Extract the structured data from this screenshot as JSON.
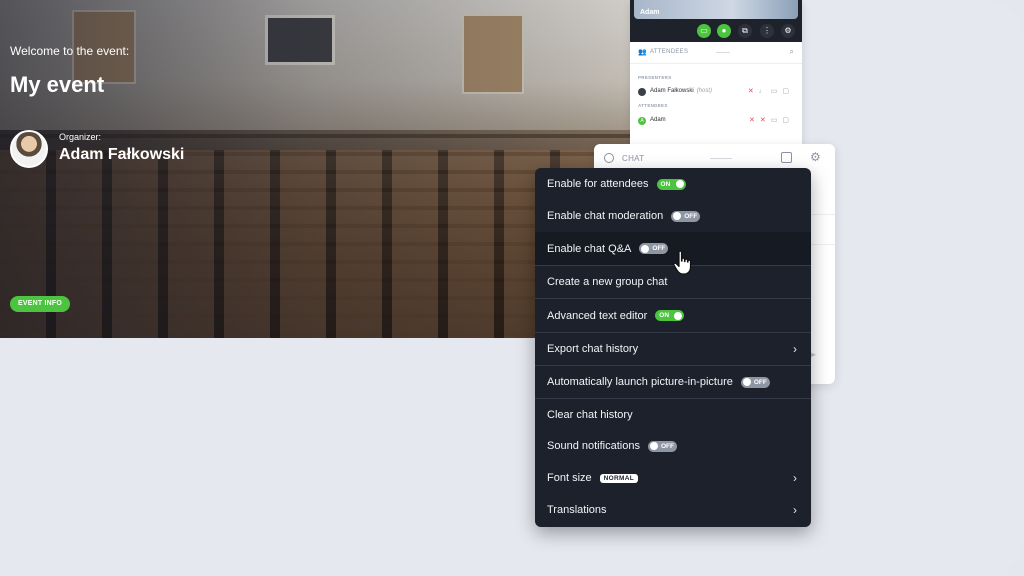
{
  "hero": {
    "welcome": "Welcome to the event:",
    "title": "My event",
    "organizer_label": "Organizer:",
    "organizer_name": "Adam Fałkowski",
    "event_info_button": "EVENT INFO"
  },
  "attendees_panel": {
    "video_name": "Adam",
    "header_label": "ATTENDEES",
    "presenters_label": "PRESENTERS",
    "attendees_label": "ATTENDEES",
    "presenter": {
      "name": "Adam Fałkowski",
      "role": "(host)"
    },
    "attendee": {
      "name": "Adam",
      "initial": "A"
    }
  },
  "chat_panel": {
    "header_label": "CHAT"
  },
  "menu": {
    "items": [
      {
        "label": "Enable for attendees",
        "toggle": "ON"
      },
      {
        "label": "Enable chat moderation",
        "toggle": "OFF"
      },
      {
        "label": "Enable chat Q&A",
        "toggle": "OFF"
      },
      {
        "label": "Create a new group chat"
      },
      {
        "label": "Advanced text editor",
        "toggle": "ON"
      },
      {
        "label": "Export chat history"
      },
      {
        "label": "Automatically launch picture-in-picture",
        "toggle": "OFF"
      },
      {
        "label": "Clear chat history"
      },
      {
        "label": "Sound notifications",
        "toggle": "OFF"
      },
      {
        "label": "Font size",
        "badge": "NORMAL"
      },
      {
        "label": "Translations"
      }
    ]
  },
  "colors": {
    "accent_green": "#4cc43f",
    "menu_bg": "#1d212b",
    "toggle_off": "#8f96a3"
  }
}
